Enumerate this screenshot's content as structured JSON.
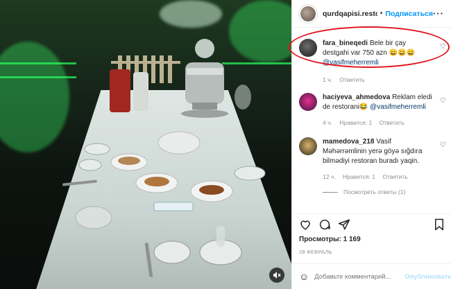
{
  "post": {
    "username": "qurdqapisi.restoran",
    "follow_label": "Подписаться",
    "more_icon": "more-horizontal-icon",
    "views_label": "Просмотры: 1 169",
    "date": "28 ФЕВРАЛЬ",
    "mute_icon": "volume-off-icon"
  },
  "comments": [
    {
      "username": "fara_bineqedi",
      "text": "Bele bir çay destgahi var 750 azn 😄😄😄",
      "mention": "@vasifmeherremli",
      "time": "1 ч.",
      "likes": "",
      "reply_label": "Ответить"
    },
    {
      "username": "haciyeva_ahmedova",
      "text": "Reklam eledi de restorani😂",
      "mention": "@vasifmeherremli",
      "time": "4 ч.",
      "likes": "Нравится: 1",
      "reply_label": "Ответить"
    },
    {
      "username": "mamedova_218",
      "text": "Vasif Məhərrəmlinin yerə göyə sığdıra bilmədiyi restoran buradı yaqin.",
      "mention": "",
      "time": "12 ч.",
      "likes": "Нравится: 1",
      "reply_label": "Ответить"
    }
  ],
  "view_replies_label": "Посмотреть ответы (1)",
  "add_comment": {
    "placeholder": "Добавьте комментарий...",
    "publish_label": "Опубликовать"
  },
  "colors": {
    "accent_blue": "#0095f6",
    "highlight_red": "#e2141c",
    "neon_green": "#39ff6a"
  }
}
